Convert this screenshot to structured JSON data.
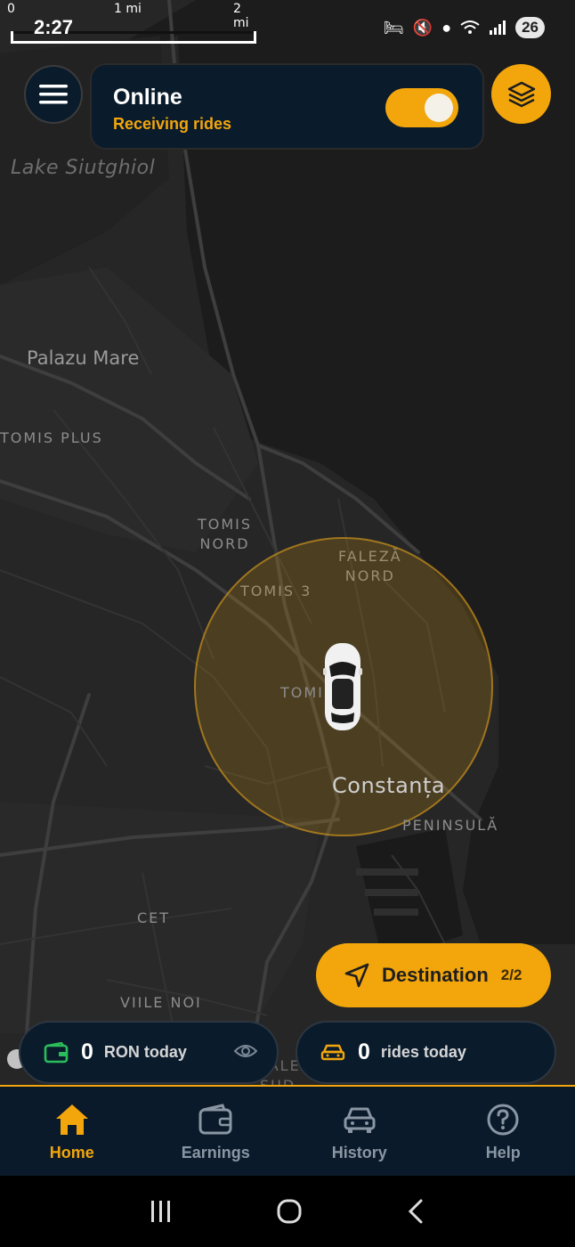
{
  "status_bar": {
    "time": "2:27",
    "scale": {
      "start": "0",
      "mid": "1 mi",
      "end": "2 mi"
    },
    "battery": "26",
    "icons": [
      "bed-icon",
      "mute-icon",
      "location-icon",
      "wifi-icon",
      "signal-icon",
      "battery-icon"
    ]
  },
  "map": {
    "labels": {
      "lake": "Lake Siutghiol",
      "palazu": "Palazu Mare",
      "tomis_plus": "TOMIS PLUS",
      "tomis_nord_1": "TOMIS",
      "tomis_nord_2": "NORD",
      "tomis3": "TOMIS 3",
      "faleza_1": "FALEZĂ",
      "faleza_2": "NORD",
      "tomi": "TOMI",
      "constanta": "Constanța",
      "peninsula": "PENINSULĂ",
      "cet": "CET",
      "viile_noi": "VIILE NOI",
      "faleza_sud_1": "FALEZ",
      "faleza_sud_2": "SUD"
    },
    "attribution": "mapbox"
  },
  "online_card": {
    "title": "Online",
    "subtitle": "Receiving rides",
    "toggle_on": true
  },
  "destination": {
    "label": "Destination",
    "count": "2/2"
  },
  "stats": {
    "earnings_value": "0",
    "earnings_label": "RON today",
    "rides_value": "0",
    "rides_label": "rides today"
  },
  "bottom_nav": {
    "items": [
      {
        "label": "Home",
        "icon": "home-icon",
        "active": true
      },
      {
        "label": "Earnings",
        "icon": "wallet-icon",
        "active": false
      },
      {
        "label": "History",
        "icon": "car-icon",
        "active": false
      },
      {
        "label": "Help",
        "icon": "help-icon",
        "active": false
      }
    ]
  },
  "colors": {
    "accent": "#f2a60c",
    "card_bg": "#0a1b2c",
    "map_bg": "#262626",
    "wallet_green": "#2bbd5a"
  }
}
